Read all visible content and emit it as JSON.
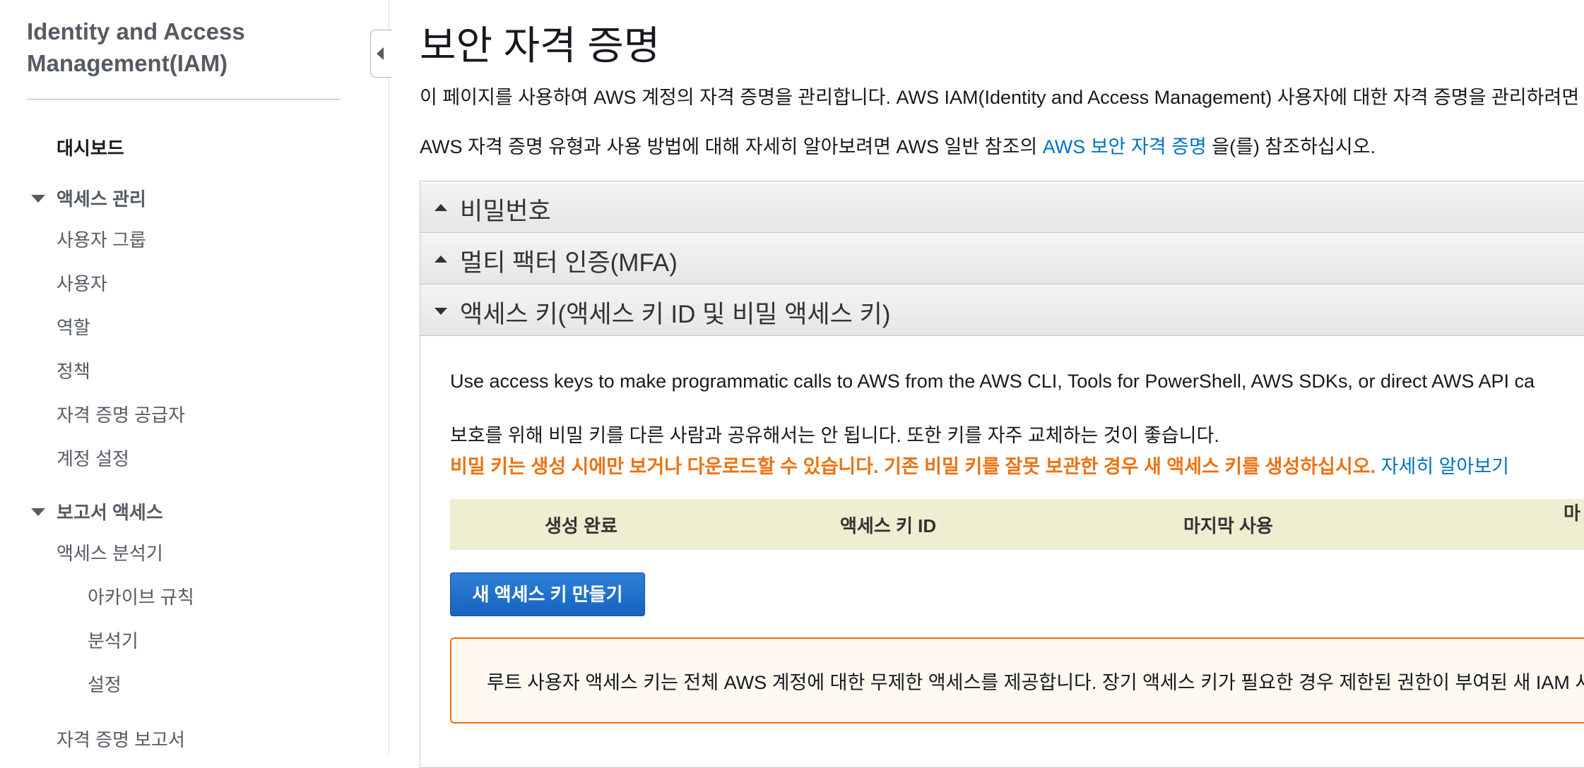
{
  "sidebar": {
    "title": "Identity and Access Management(IAM)",
    "dashboard": "대시보드",
    "access_management": {
      "label": "액세스 관리",
      "items": [
        "사용자 그룹",
        "사용자",
        "역할",
        "정책",
        "자격 증명 공급자",
        "계정 설정"
      ]
    },
    "report_access": {
      "label": "보고서 액세스",
      "analyzer": "액세스 분석기",
      "analyzer_items": [
        "아카이브 규칙",
        "분석기",
        "설정"
      ],
      "credential_report": "자격 증명 보고서"
    }
  },
  "main": {
    "title": "보안 자격 증명",
    "intro1": "이 페이지를 사용하여 AWS 계정의 자격 증명을 관리합니다. AWS IAM(Identity and Access Management) 사용자에 대한 자격 증명을 관리하려면",
    "intro2_prefix": "AWS 자격 증명 유형과 사용 방법에 대해 자세히 알아보려면 AWS 일반 참조의 ",
    "intro2_link": "AWS 보안 자격 증명",
    "intro2_suffix": " 을(를) 참조하십시오.",
    "sections": {
      "password": "비밀번호",
      "mfa": "멀티 팩터 인증(MFA)",
      "access_keys": "액세스 키(액세스 키 ID 및 비밀 액세스 키)"
    },
    "access_keys": {
      "desc": "Use access keys to make programmatic calls to AWS from the AWS CLI, Tools for PowerShell, AWS SDKs, or direct AWS API ca",
      "protect_text": "보호를 위해 비밀 키를 다른 사람과 공유해서는 안 됩니다. 또한 키를 자주 교체하는 것이 좋습니다.",
      "warning_text": "비밀 키는 생성 시에만 보거나 다운로드할 수 있습니다. 기존 비밀 키를 잘못 보관한 경우 새 액세스 키를 생성하십시오.",
      "learn_more": "자세히 알아보기",
      "columns": [
        "생성 완료",
        "액세스 키 ID",
        "마지막 사용",
        "마"
      ],
      "create_button": "새 액세스 키 만들기",
      "notice": "루트 사용자 액세스 키는 전체 AWS 계정에 대한 무제한 액세스를 제공합니다. 장기 액세스 키가 필요한 경우 제한된 권한이 부여된 새 IAM 사용"
    }
  }
}
